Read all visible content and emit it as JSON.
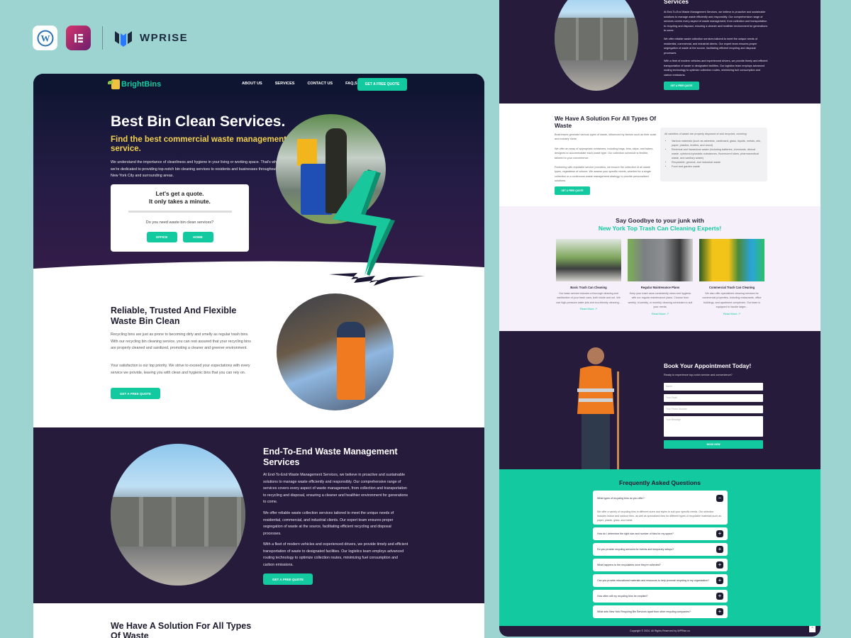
{
  "brand": {
    "wordpress_icon": "wordpress-icon",
    "elementor_icon": "elementor-icon",
    "wprise_label": "WPRISE"
  },
  "left": {
    "nav": {
      "logo": "BrightBins",
      "links": [
        "ABOUT US",
        "SERVICES",
        "CONTACT US",
        "FAQ,S"
      ],
      "cta": "GET A FREE QUOTE"
    },
    "hero": {
      "title": "Best Bin Clean Services.",
      "subtitle": "Find the best commercial waste management service.",
      "body": "We understand the importance of cleanliness and hygiene in your living or working space. That's why we're dedicated to providing top-notch bin cleaning services to residents and businesses throughout New York City and surrounding areas.",
      "quote": {
        "title_line1": "Let's get a quote.",
        "title_line2": "It only takes a minute.",
        "question": "Do you need waste bin clean services?",
        "options": [
          "OFFICE",
          "HOME"
        ]
      }
    },
    "reliable": {
      "title": "Reliable, Trusted And Flexible Waste Bin Clean",
      "p1": "Recycling bins are just as prone to becoming dirty and smelly as regular trash bins. With our recycling bin cleaning service, you can rest assured that your recycling bins are properly cleaned and sanitized, promoting a cleaner and greener environment.",
      "p2": "Your satisfaction is our top priority. We strive to exceed your expectations with every service we provide, leaving you with clean and hygienic bins that you can rely on.",
      "cta": "GET A FREE QUOTE"
    },
    "endtoend": {
      "title": "End-To-End Waste Management Services",
      "p1": "At End-To-End Waste Management Services, we believe in proactive and sustainable solutions to manage waste efficiently and responsibly. Our comprehensive range of services covers every aspect of waste management, from collection and transportation to recycling and disposal, ensuring a cleaner and healthier environment for generations to come.",
      "p2": "We offer reliable waste collection services tailored to meet the unique needs of residential, commercial, and industrial clients. Our expert team ensures proper segregation of waste at the source, facilitating efficient recycling and disposal processes.",
      "p3": "With a fleet of modern vehicles and experienced drivers, we provide timely and efficient transportation of waste to designated facilities. Our logistics team employs advanced routing technology to optimize collection routes, minimizing fuel consumption and carbon emissions.",
      "cta": "GET A FREE QUOTE"
    },
    "solution_title": "We Have A Solution For All Types Of Waste"
  },
  "right": {
    "services_title": "Services",
    "services_cta": "GET A FREE QUOTE",
    "solution": {
      "title": "We Have A Solution For All Types Of Waste",
      "p1": "Businesses generate various types of waste, influenced by factors such as their scale and industry niche.",
      "p2": "We offer an array of appropriate containers, including bags, bins, skips, and balers, designed to accommodate each waste type. Our collection schedule is flexible, tailored to your convenience.",
      "p3": "Partnering with reputable service providers, we ensure the collection of all waste types, regardless of volume. We assess your specific needs, whether for a single collection or a continuous waste management strategy, to provide personalized solutions.",
      "cta": "GET A FREE QUOTE",
      "box_intro": "All varieties of waste are properly disposed of and recycled, covering:",
      "box_items": [
        "Various materials (such as asbestos, cardboard, glass, liquids, metals, oils, paper, plastics, textiles, and wood)",
        "Electrical and hazardous waste (including batteries, chemicals, clinical waste, cytotoxic/cytostatic substances, fluorescent tubes, pharmaceutical waste, and sanitary waste)",
        "Recyclable, general, and industrial waste",
        "Food and garden waste"
      ]
    },
    "goodbye": {
      "line1": "Say Goodbye to your junk with",
      "line2": "New York Top Trash Can Cleaning Experts!",
      "cards": [
        {
          "title": "Basic Trash Can Cleaning",
          "desc": "Our basic service includes a thorough cleaning and sanitization of your trash cans, both inside and out. We use high-pressure water jets and eco-friendly cleaning...",
          "link": "Read More"
        },
        {
          "title": "Regular Maintenance Plans",
          "desc": "Keep your trash cans consistently clean and hygienic with our regular maintenance plans. Choose from weekly, bi-weekly, or monthly cleaning schedules to suit your needs.",
          "link": "Read More"
        },
        {
          "title": "Commercial Trash Can Cleaning",
          "desc": "We also offer specialized cleaning services for commercial properties, including restaurants, office buildings, and apartment complexes. Our team is equipped to handle larger...",
          "link": "Read More"
        }
      ]
    },
    "booking": {
      "title": "Book Your Appointment Today!",
      "subtitle": "Ready to experience top-notch service and convenience?",
      "name_placeholder": "Name",
      "email_placeholder": "Your Email",
      "phone_placeholder": "Your Phone Number",
      "message_placeholder": "Your Message",
      "submit": "BOOK NOW"
    },
    "faq": {
      "title": "Frequently Asked Questions",
      "items": [
        {
          "q": "What types of recycling bins do you offer?",
          "a": "We offer a variety of recycling bins in different sizes and styles to suit your specific needs. Our selection includes indoor and outdoor bins, as well as specialized bins for different types of recyclable materials such as paper, plastic, glass, and metal.",
          "open": true
        },
        {
          "q": "How do I determine the right size and number of bins for my space?",
          "open": false
        },
        {
          "q": "Do you provide recycling services for events and temporary setups?",
          "open": false
        },
        {
          "q": "What happens to the recyclables once they're collected?",
          "open": false
        },
        {
          "q": "Can you provide educational materials and resources to help promote recycling in my organization?",
          "open": false
        },
        {
          "q": "How often will my recycling bins be emptied?",
          "open": false
        },
        {
          "q": "What sets New York Recycling Bin Services apart from other recycling companies?",
          "open": false
        }
      ]
    },
    "footer": "Copyright © 2024. All Rights Reserved by WPRise.co"
  },
  "colors": {
    "accent": "#13c9a0",
    "dark": "#271b3c",
    "highlight": "#f1d04c",
    "background": "#9dd3d1"
  }
}
